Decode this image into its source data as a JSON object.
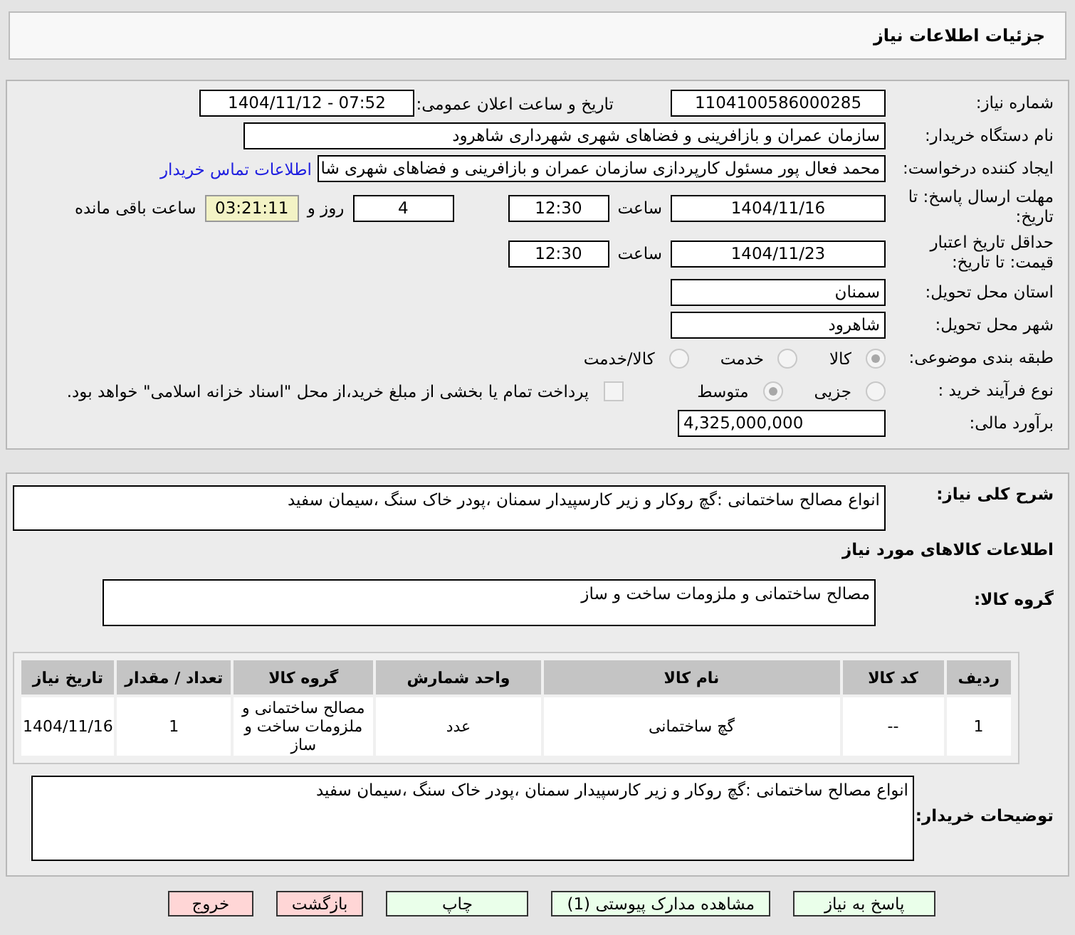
{
  "header": {
    "title": "جزئیات اطلاعات نیاز"
  },
  "need_number": {
    "label": "شماره نیاز:",
    "value": "1104100586000285"
  },
  "announce": {
    "label": "تاریخ و ساعت اعلان عمومی:",
    "value": "1404/11/12 - 07:52"
  },
  "buyer_org": {
    "label": "نام دستگاه خریدار:",
    "value": "سازمان عمران و بازافرینی و فضاهای شهری شهرداری شاهرود"
  },
  "requester": {
    "label": "ایجاد کننده درخواست:",
    "value": "محمد فعال پور مسئول کارپردازی سازمان عمران و بازافرینی و فضاهای شهری شا",
    "link": "اطلاعات تماس خریدار"
  },
  "deadline": {
    "label": "مهلت ارسال پاسخ: تا تاریخ:",
    "date": "1404/11/16",
    "time_label": "ساعت",
    "time": "12:30",
    "days": "4",
    "days_label": "روز و",
    "remaining": "03:21:11",
    "remaining_label": "ساعت باقی مانده"
  },
  "validity": {
    "label": "حداقل تاریخ اعتبار قیمت: تا تاریخ:",
    "date": "1404/11/23",
    "time_label": "ساعت",
    "time": "12:30"
  },
  "province": {
    "label": "استان محل تحویل:",
    "value": "سمنان"
  },
  "city": {
    "label": "شهر محل تحویل:",
    "value": "شاهرود"
  },
  "category": {
    "label": "طبقه بندی موضوعی:",
    "options": [
      {
        "label": "کالا",
        "selected": true
      },
      {
        "label": "خدمت",
        "selected": false
      },
      {
        "label": "کالا/خدمت",
        "selected": false
      }
    ]
  },
  "process": {
    "label": "نوع فرآیند خرید :",
    "options": [
      {
        "label": "جزیی",
        "selected": false
      },
      {
        "label": "متوسط",
        "selected": true
      }
    ],
    "payment": {
      "label": "پرداخت تمام یا بخشی از مبلغ خرید،از محل \"اسناد خزانه اسلامی\" خواهد بود.",
      "checked": false
    }
  },
  "budget": {
    "label": "برآورد مالی:",
    "value": "4,325,000,000"
  },
  "description": {
    "label": "شرح کلی نیاز:",
    "value": "انواع مصالح ساختمانی :گچ روکار و زیر کارسپیدار سمنان ،پودر خاک سنگ ،سیمان سفید"
  },
  "goods_title": "اطلاعات کالاهای مورد نیاز",
  "goods_group": {
    "label": "گروه کالا:",
    "value": "مصالح ساختمانی و ملزومات ساخت و ساز"
  },
  "table": {
    "columns": [
      "ردیف",
      "کد کالا",
      "نام کالا",
      "واحد شمارش",
      "گروه کالا",
      "تعداد / مقدار",
      "تاریخ نیاز"
    ],
    "rows": [
      [
        "1",
        "--",
        "گچ ساختمانی",
        "عدد",
        "مصالح ساختمانی و ملزومات ساخت و ساز",
        "1",
        "1404/11/16"
      ]
    ]
  },
  "buyer_notes": {
    "label": "توضیحات خریدار:",
    "value": "انواع مصالح ساختمانی :گچ روکار و زیر کارسپیدار سمنان ،پودر خاک سنگ ،سیمان سفید"
  },
  "buttons": [
    {
      "label": "پاسخ به نیاز",
      "kind": "action"
    },
    {
      "label": "مشاهده مدارک پیوستی (1)",
      "kind": "action"
    },
    {
      "label": "چاپ",
      "kind": "action"
    },
    {
      "label": "بازگشت",
      "kind": "danger"
    },
    {
      "label": "خروج",
      "kind": "danger"
    }
  ]
}
